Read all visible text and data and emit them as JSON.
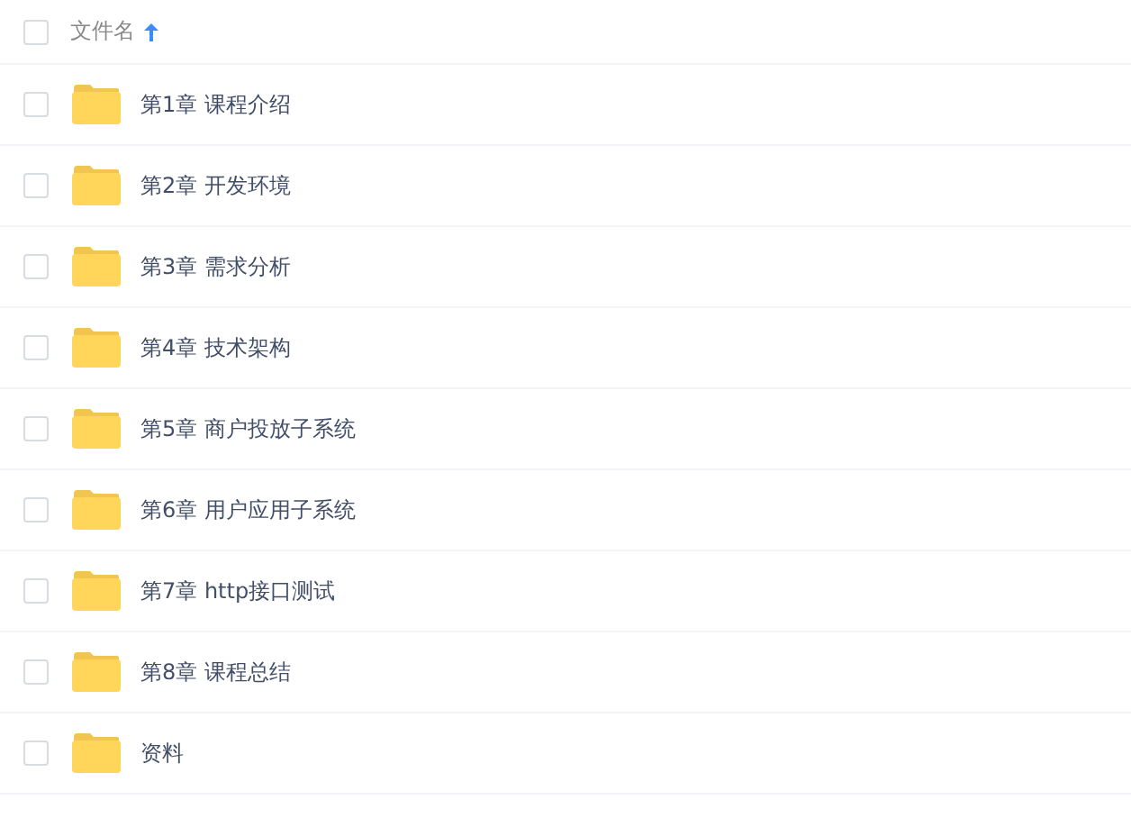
{
  "header": {
    "label": "文件名",
    "checked": false,
    "sorted_ascending": true
  },
  "files": [
    {
      "name": "第1章 课程介绍",
      "checked": false
    },
    {
      "name": "第2章 开发环境",
      "checked": false
    },
    {
      "name": "第3章 需求分析",
      "checked": false
    },
    {
      "name": "第4章 技术架构",
      "checked": false
    },
    {
      "name": "第5章 商户投放子系统",
      "checked": false
    },
    {
      "name": "第6章 用户应用子系统",
      "checked": false
    },
    {
      "name": "第7章 http接口测试",
      "checked": false
    },
    {
      "name": "第8章 课程总结",
      "checked": false
    },
    {
      "name": "资料",
      "checked": false
    }
  ]
}
